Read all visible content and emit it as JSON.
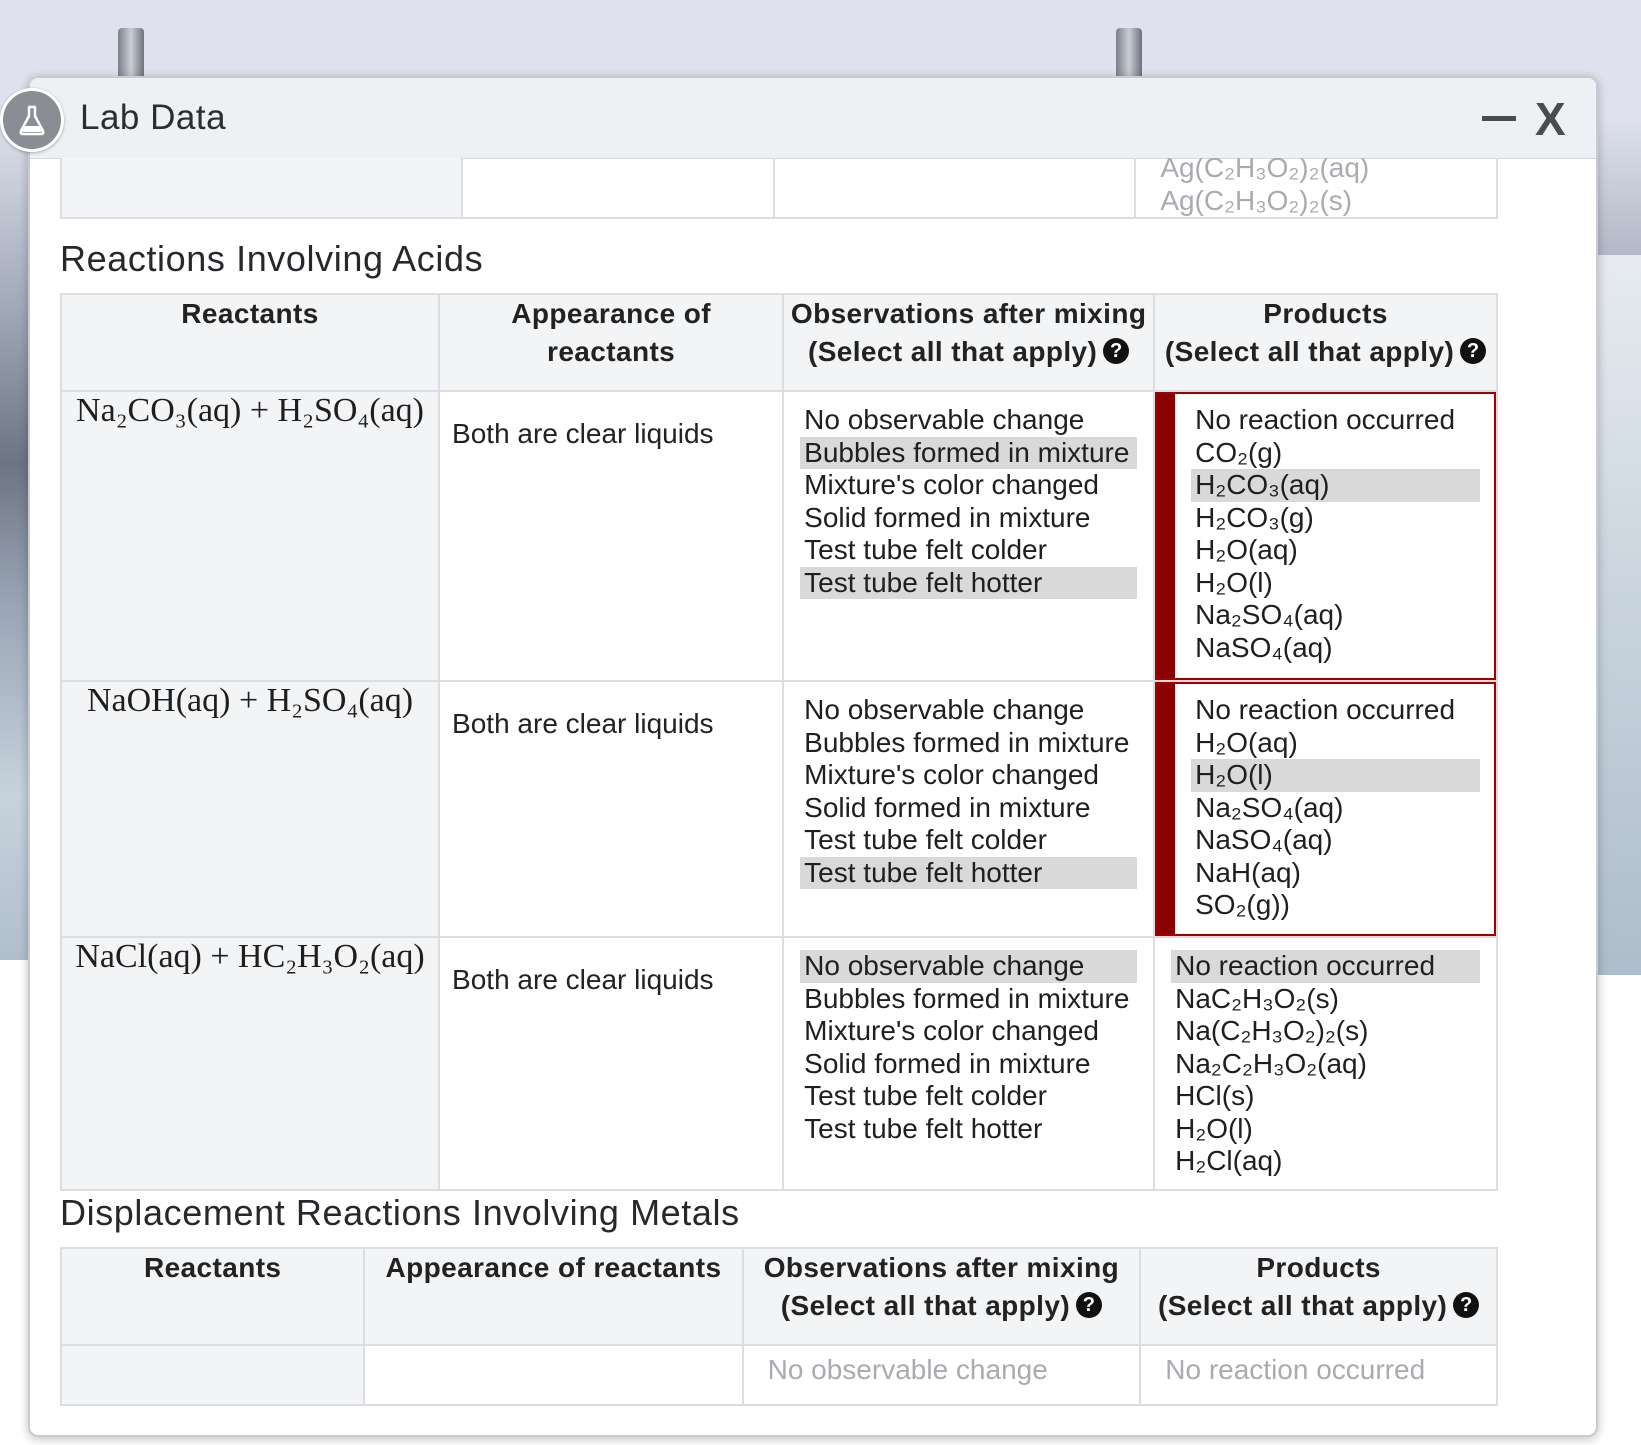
{
  "window": {
    "title": "Lab Data"
  },
  "top_fragment": {
    "products": [
      "Ag(C₂H₃O₂)₂(aq)",
      "Ag(C₂H₃O₂)₂(s)"
    ]
  },
  "acids": {
    "title": "Reactions Involving Acids",
    "headers": {
      "reactants": "Reactants",
      "appearance_1": "Appearance of",
      "appearance_2": "reactants",
      "observations_1": "Observations after mixing",
      "observations_2": "(Select all that apply)",
      "products_1": "Products",
      "products_2": "(Select all that apply)"
    },
    "rows": [
      {
        "reactants": "Na₂CO₃(aq) + H₂SO₄(aq)",
        "appearance": "Both are clear liquids",
        "observations": [
          {
            "label": "No observable change",
            "selected": false
          },
          {
            "label": "Bubbles formed in mixture",
            "selected": true
          },
          {
            "label": "Mixture's color changed",
            "selected": false
          },
          {
            "label": "Solid formed in mixture",
            "selected": false
          },
          {
            "label": "Test tube felt colder",
            "selected": false
          },
          {
            "label": "Test tube felt hotter",
            "selected": true
          }
        ],
        "products": [
          {
            "label": "No reaction occurred",
            "selected": false
          },
          {
            "label": "CO₂(g)",
            "selected": false
          },
          {
            "label": "H₂CO₃(aq)",
            "selected": true
          },
          {
            "label": "H₂CO₃(g)",
            "selected": false
          },
          {
            "label": "H₂O(aq)",
            "selected": false
          },
          {
            "label": "H₂O(l)",
            "selected": false
          },
          {
            "label": "Na₂SO₄(aq)",
            "selected": false
          },
          {
            "label": "NaSO₄(aq)",
            "selected": false
          }
        ]
      },
      {
        "reactants": "NaOH(aq) + H₂SO₄(aq)",
        "appearance": "Both are clear liquids",
        "observations": [
          {
            "label": "No observable change",
            "selected": false
          },
          {
            "label": "Bubbles formed in mixture",
            "selected": false
          },
          {
            "label": "Mixture's color changed",
            "selected": false
          },
          {
            "label": "Solid formed in mixture",
            "selected": false
          },
          {
            "label": "Test tube felt colder",
            "selected": false
          },
          {
            "label": "Test tube felt hotter",
            "selected": true
          }
        ],
        "products": [
          {
            "label": "No reaction occurred",
            "selected": false
          },
          {
            "label": "H₂O(aq)",
            "selected": false
          },
          {
            "label": "H₂O(l)",
            "selected": true
          },
          {
            "label": "Na₂SO₄(aq)",
            "selected": false
          },
          {
            "label": "NaSO₄(aq)",
            "selected": false
          },
          {
            "label": "NaH(aq)",
            "selected": false
          },
          {
            "label": "SO₂(g))",
            "selected": false
          }
        ]
      },
      {
        "reactants": "NaCl(aq) + HC₂H₃O₂(aq)",
        "appearance": "Both are clear liquids",
        "observations": [
          {
            "label": "No observable change",
            "selected": true
          },
          {
            "label": "Bubbles formed in mixture",
            "selected": false
          },
          {
            "label": "Mixture's color changed",
            "selected": false
          },
          {
            "label": "Solid formed in mixture",
            "selected": false
          },
          {
            "label": "Test tube felt colder",
            "selected": false
          },
          {
            "label": "Test tube felt hotter",
            "selected": false
          }
        ],
        "products": [
          {
            "label": "No reaction occurred",
            "selected": true
          },
          {
            "label": "NaC₂H₃O₂(s)",
            "selected": false
          },
          {
            "label": "Na(C₂H₃O₂)₂(s)",
            "selected": false
          },
          {
            "label": "Na₂C₂H₃O₂(aq)",
            "selected": false
          },
          {
            "label": "HCl(s)",
            "selected": false
          },
          {
            "label": "H₂O(l)",
            "selected": false
          },
          {
            "label": "H₂Cl(aq)",
            "selected": false
          }
        ]
      }
    ]
  },
  "metals": {
    "title": "Displacement Reactions Involving Metals",
    "headers": {
      "reactants": "Reactants",
      "appearance": "Appearance of reactants",
      "observations_1": "Observations after mixing",
      "observations_2": "(Select all that apply)",
      "products_1": "Products",
      "products_2": "(Select all that apply)"
    },
    "first_row": {
      "observation": "No observable change",
      "product": "No reaction occurred"
    }
  },
  "help_symbol": "?",
  "colors": {
    "error": "#8b0000",
    "selected": "#d9d9d9",
    "header_bg": "#f3f4f6"
  }
}
